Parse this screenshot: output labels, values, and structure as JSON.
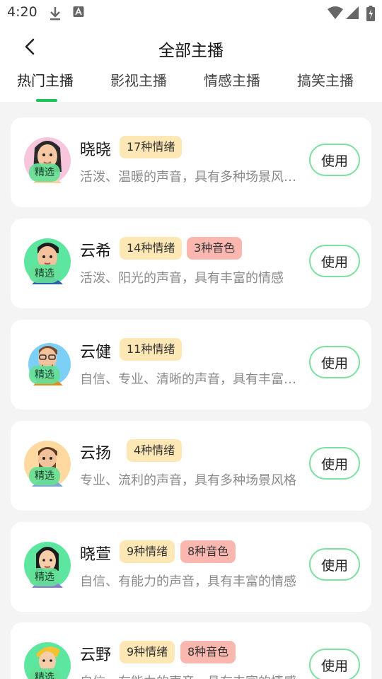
{
  "status_bar": {
    "time": "4:20",
    "icons": [
      "download-icon",
      "text-a-icon",
      "wifi-icon",
      "signal-icon",
      "battery-icon"
    ]
  },
  "header": {
    "title": "全部主播",
    "back_icon": "chevron-left-icon"
  },
  "tabs": [
    {
      "label": "热门主播",
      "active": true
    },
    {
      "label": "影视主播",
      "active": false
    },
    {
      "label": "情感主播",
      "active": false
    },
    {
      "label": "搞笑主播",
      "active": false
    }
  ],
  "accent_color": "#19c459",
  "pick_badge": "精选",
  "use_label": "使用",
  "voices": [
    {
      "name": "晓晓",
      "emotion_tag": "17种情绪",
      "voice_tag": "",
      "description": "活泼、温暖的声音，具有多种场景风格和情感"
    },
    {
      "name": "云希",
      "emotion_tag": "14种情绪",
      "voice_tag": "3种音色",
      "description": "活泼、阳光的声音，具有丰富的情感"
    },
    {
      "name": "云健",
      "emotion_tag": "11种情绪",
      "voice_tag": "",
      "description": "自信、专业、清晰的声音，具有丰富的情感"
    },
    {
      "name": "云扬",
      "emotion_tag": "4种情绪",
      "voice_tag": "",
      "description": "专业、流利的声音，具有多种场景风格"
    },
    {
      "name": "晓萱",
      "emotion_tag": "9种情绪",
      "voice_tag": "8种音色",
      "description": "自信、有能力的声音，具有丰富的情感"
    },
    {
      "name": "云野",
      "emotion_tag": "9种情绪",
      "voice_tag": "8种音色",
      "description": "自信、有能力的声音，具有丰富的情感"
    }
  ]
}
